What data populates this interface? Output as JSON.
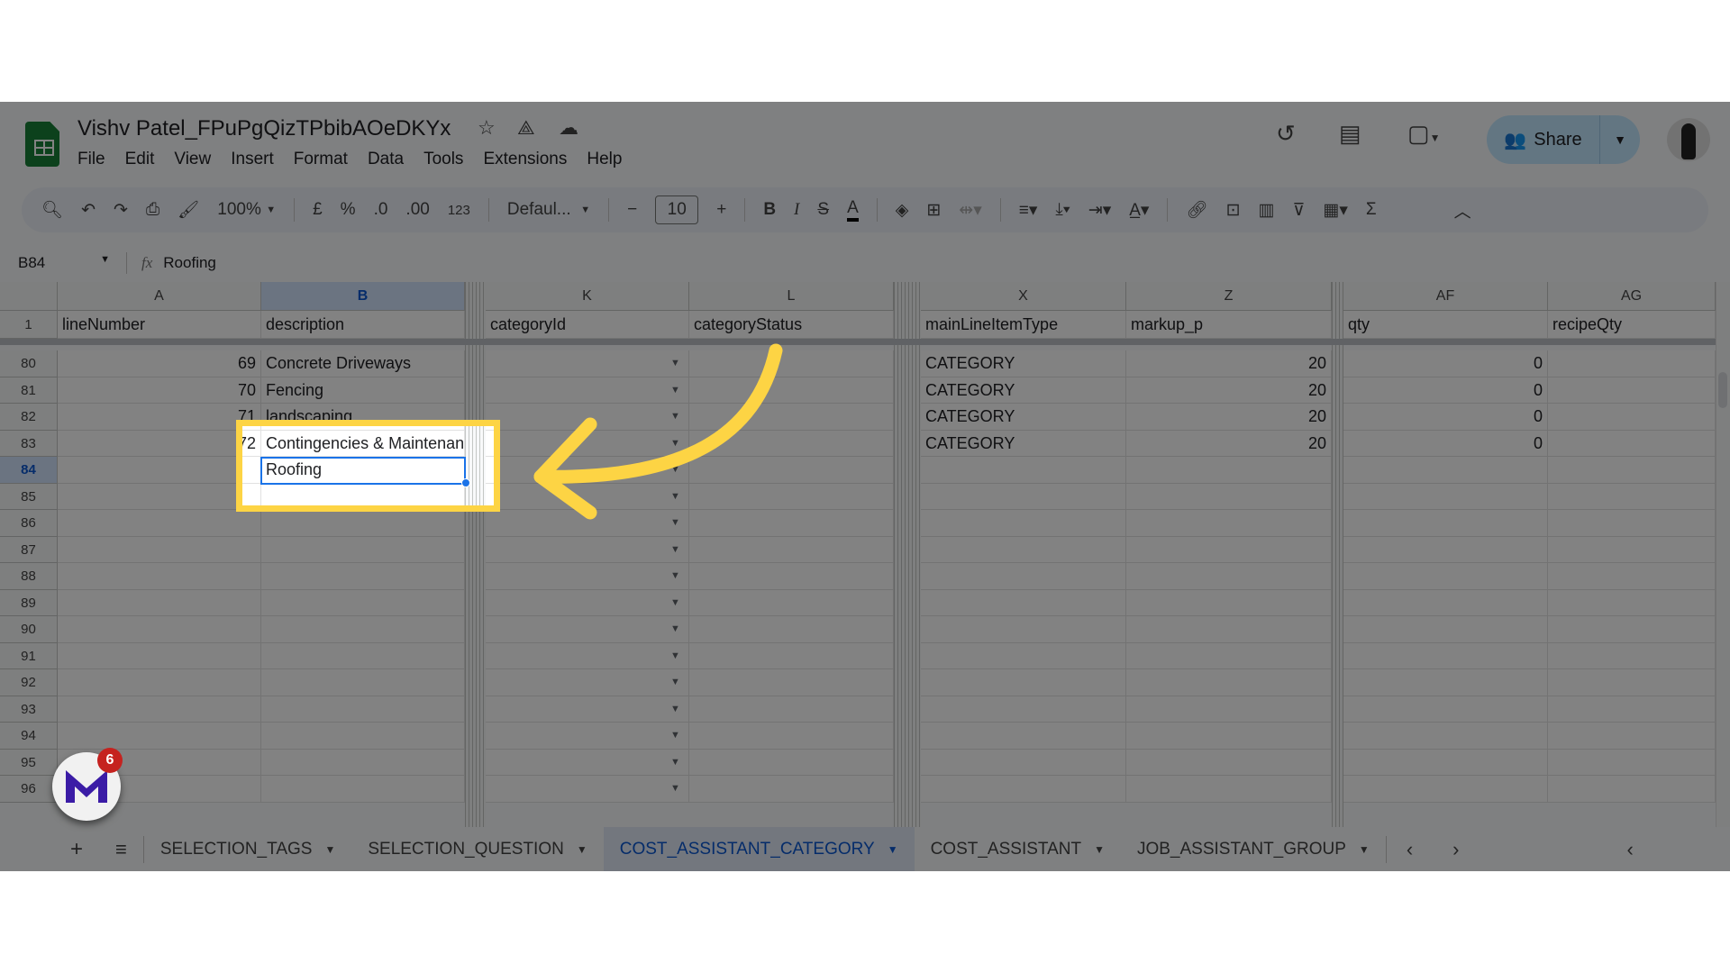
{
  "doc": {
    "title": "Vishv Patel_FPuPgQizTPbibAOeDKYx"
  },
  "menu": [
    "File",
    "Edit",
    "View",
    "Insert",
    "Format",
    "Data",
    "Tools",
    "Extensions",
    "Help"
  ],
  "share": {
    "label": "Share"
  },
  "toolbar": {
    "zoom": "100%",
    "currency": "£",
    "percent": "%",
    "dec_decrease": ".0",
    "dec_increase": ".00",
    "number_format": "123",
    "font": "Defaul...",
    "font_size": "10"
  },
  "formula_bar": {
    "name_box": "B84",
    "fx": "fx",
    "value": "Roofing"
  },
  "columns": [
    "A",
    "B",
    "K",
    "L",
    "X",
    "Z",
    "AF",
    "AG"
  ],
  "header_row": {
    "row": "1",
    "cells": [
      "lineNumber",
      "description",
      "categoryId",
      "categoryStatus",
      "mainLineItemType",
      "markup_p",
      "qty",
      "recipeQty"
    ]
  },
  "rows": [
    {
      "row": "80",
      "cells": [
        "69",
        "Concrete Driveways",
        "",
        "",
        "CATEGORY",
        "20",
        "0",
        ""
      ]
    },
    {
      "row": "81",
      "cells": [
        "70",
        "Fencing",
        "",
        "",
        "CATEGORY",
        "20",
        "0",
        ""
      ]
    },
    {
      "row": "82",
      "cells": [
        "71",
        "landscaping",
        "",
        "",
        "CATEGORY",
        "20",
        "0",
        ""
      ]
    },
    {
      "row": "83",
      "cells": [
        "72",
        "Contingencies & Maintenance",
        "",
        "",
        "CATEGORY",
        "20",
        "0",
        ""
      ]
    },
    {
      "row": "84",
      "cells": [
        "",
        "Roofing",
        "",
        "",
        "",
        "",
        "",
        ""
      ]
    },
    {
      "row": "85",
      "cells": [
        "",
        "",
        "",
        "",
        "",
        "",
        "",
        ""
      ]
    },
    {
      "row": "86",
      "cells": [
        "",
        "",
        "",
        "",
        "",
        "",
        "",
        ""
      ]
    },
    {
      "row": "87",
      "cells": [
        "",
        "",
        "",
        "",
        "",
        "",
        "",
        ""
      ]
    },
    {
      "row": "88",
      "cells": [
        "",
        "",
        "",
        "",
        "",
        "",
        "",
        ""
      ]
    },
    {
      "row": "89",
      "cells": [
        "",
        "",
        "",
        "",
        "",
        "",
        "",
        ""
      ]
    },
    {
      "row": "90",
      "cells": [
        "",
        "",
        "",
        "",
        "",
        "",
        "",
        ""
      ]
    },
    {
      "row": "91",
      "cells": [
        "",
        "",
        "",
        "",
        "",
        "",
        "",
        ""
      ]
    },
    {
      "row": "92",
      "cells": [
        "",
        "",
        "",
        "",
        "",
        "",
        "",
        ""
      ]
    },
    {
      "row": "93",
      "cells": [
        "",
        "",
        "",
        "",
        "",
        "",
        "",
        ""
      ]
    },
    {
      "row": "94",
      "cells": [
        "",
        "",
        "",
        "",
        "",
        "",
        "",
        ""
      ]
    },
    {
      "row": "95",
      "cells": [
        "",
        "",
        "",
        "",
        "",
        "",
        "",
        ""
      ]
    },
    {
      "row": "96",
      "cells": [
        "",
        "",
        "",
        "",
        "",
        "",
        "",
        ""
      ]
    }
  ],
  "active_cell": "B84",
  "sheet_tabs": [
    {
      "label": "SELECTION_TAGS",
      "active": false
    },
    {
      "label": "SELECTION_QUESTION",
      "active": false
    },
    {
      "label": "COST_ASSISTANT_CATEGORY",
      "active": true
    },
    {
      "label": "COST_ASSISTANT",
      "active": false
    },
    {
      "label": "JOB_ASSISTANT_GROUP",
      "active": false
    }
  ],
  "extension_badge": {
    "count": "6"
  },
  "colors": {
    "highlight": "#fdd444",
    "accent": "#1a73e8",
    "share_bg": "#c2e7ff",
    "sheets_green": "#188038",
    "overlay": "rgba(0,0,0,0.49)"
  }
}
